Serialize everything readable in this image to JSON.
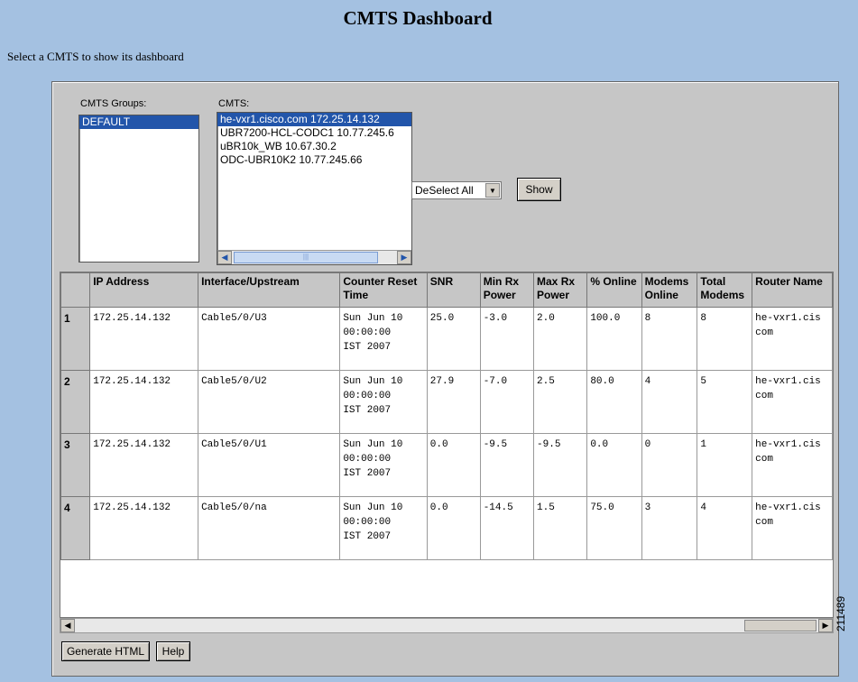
{
  "page": {
    "title": "CMTS Dashboard",
    "subtitle": "Select a CMTS to show its dashboard",
    "figure_number": "211489"
  },
  "groups": {
    "label": "CMTS Groups:",
    "items": [
      {
        "label": "DEFAULT",
        "selected": true
      }
    ]
  },
  "cmts": {
    "label": "CMTS:",
    "items": [
      {
        "label": "he-vxr1.cisco.com 172.25.14.132",
        "selected": true
      },
      {
        "label": "UBR7200-HCL-CODC1 10.77.245.6",
        "selected": false
      },
      {
        "label": "uBR10k_WB 10.67.30.2",
        "selected": false
      },
      {
        "label": "ODC-UBR10K2 10.77.245.66",
        "selected": false
      }
    ]
  },
  "controls": {
    "select_mode": "DeSelect All",
    "show_label": "Show",
    "generate_label": "Generate HTML",
    "help_label": "Help"
  },
  "table": {
    "headers": [
      "",
      "IP Address",
      "Interface/Upstream",
      "Counter Reset Time",
      "SNR",
      "Min Rx Power",
      "Max Rx Power",
      "% Online",
      "Modems Online",
      "Total Modems",
      "Router Name"
    ],
    "rows": [
      {
        "num": "1",
        "ip": "172.25.14.132",
        "iface": "Cable5/0/U3",
        "reset": "Sun Jun 10\n00:00:00\nIST 2007",
        "snr": "25.0",
        "min_rx": "-3.0",
        "max_rx": "2.0",
        "online_pct": "100.0",
        "modems_online": "8",
        "total_modems": "8",
        "router": "he-vxr1.cis\ncom"
      },
      {
        "num": "2",
        "ip": "172.25.14.132",
        "iface": "Cable5/0/U2",
        "reset": "Sun Jun 10\n00:00:00\nIST 2007",
        "snr": "27.9",
        "min_rx": "-7.0",
        "max_rx": "2.5",
        "online_pct": "80.0",
        "modems_online": "4",
        "total_modems": "5",
        "router": "he-vxr1.cis\ncom"
      },
      {
        "num": "3",
        "ip": "172.25.14.132",
        "iface": "Cable5/0/U1",
        "reset": "Sun Jun 10\n00:00:00\nIST 2007",
        "snr": "0.0",
        "min_rx": "-9.5",
        "max_rx": "-9.5",
        "online_pct": "0.0",
        "modems_online": "0",
        "total_modems": "1",
        "router": "he-vxr1.cis\ncom"
      },
      {
        "num": "4",
        "ip": "172.25.14.132",
        "iface": "Cable5/0/na",
        "reset": "Sun Jun 10\n00:00:00\nIST 2007",
        "snr": "0.0",
        "min_rx": "-14.5",
        "max_rx": "1.5",
        "online_pct": "75.0",
        "modems_online": "3",
        "total_modems": "4",
        "router": "he-vxr1.cis\ncom"
      }
    ]
  },
  "icons": {
    "scroll_left": "◀",
    "scroll_right": "▶",
    "dropdown": "▼",
    "grip": "|||"
  }
}
